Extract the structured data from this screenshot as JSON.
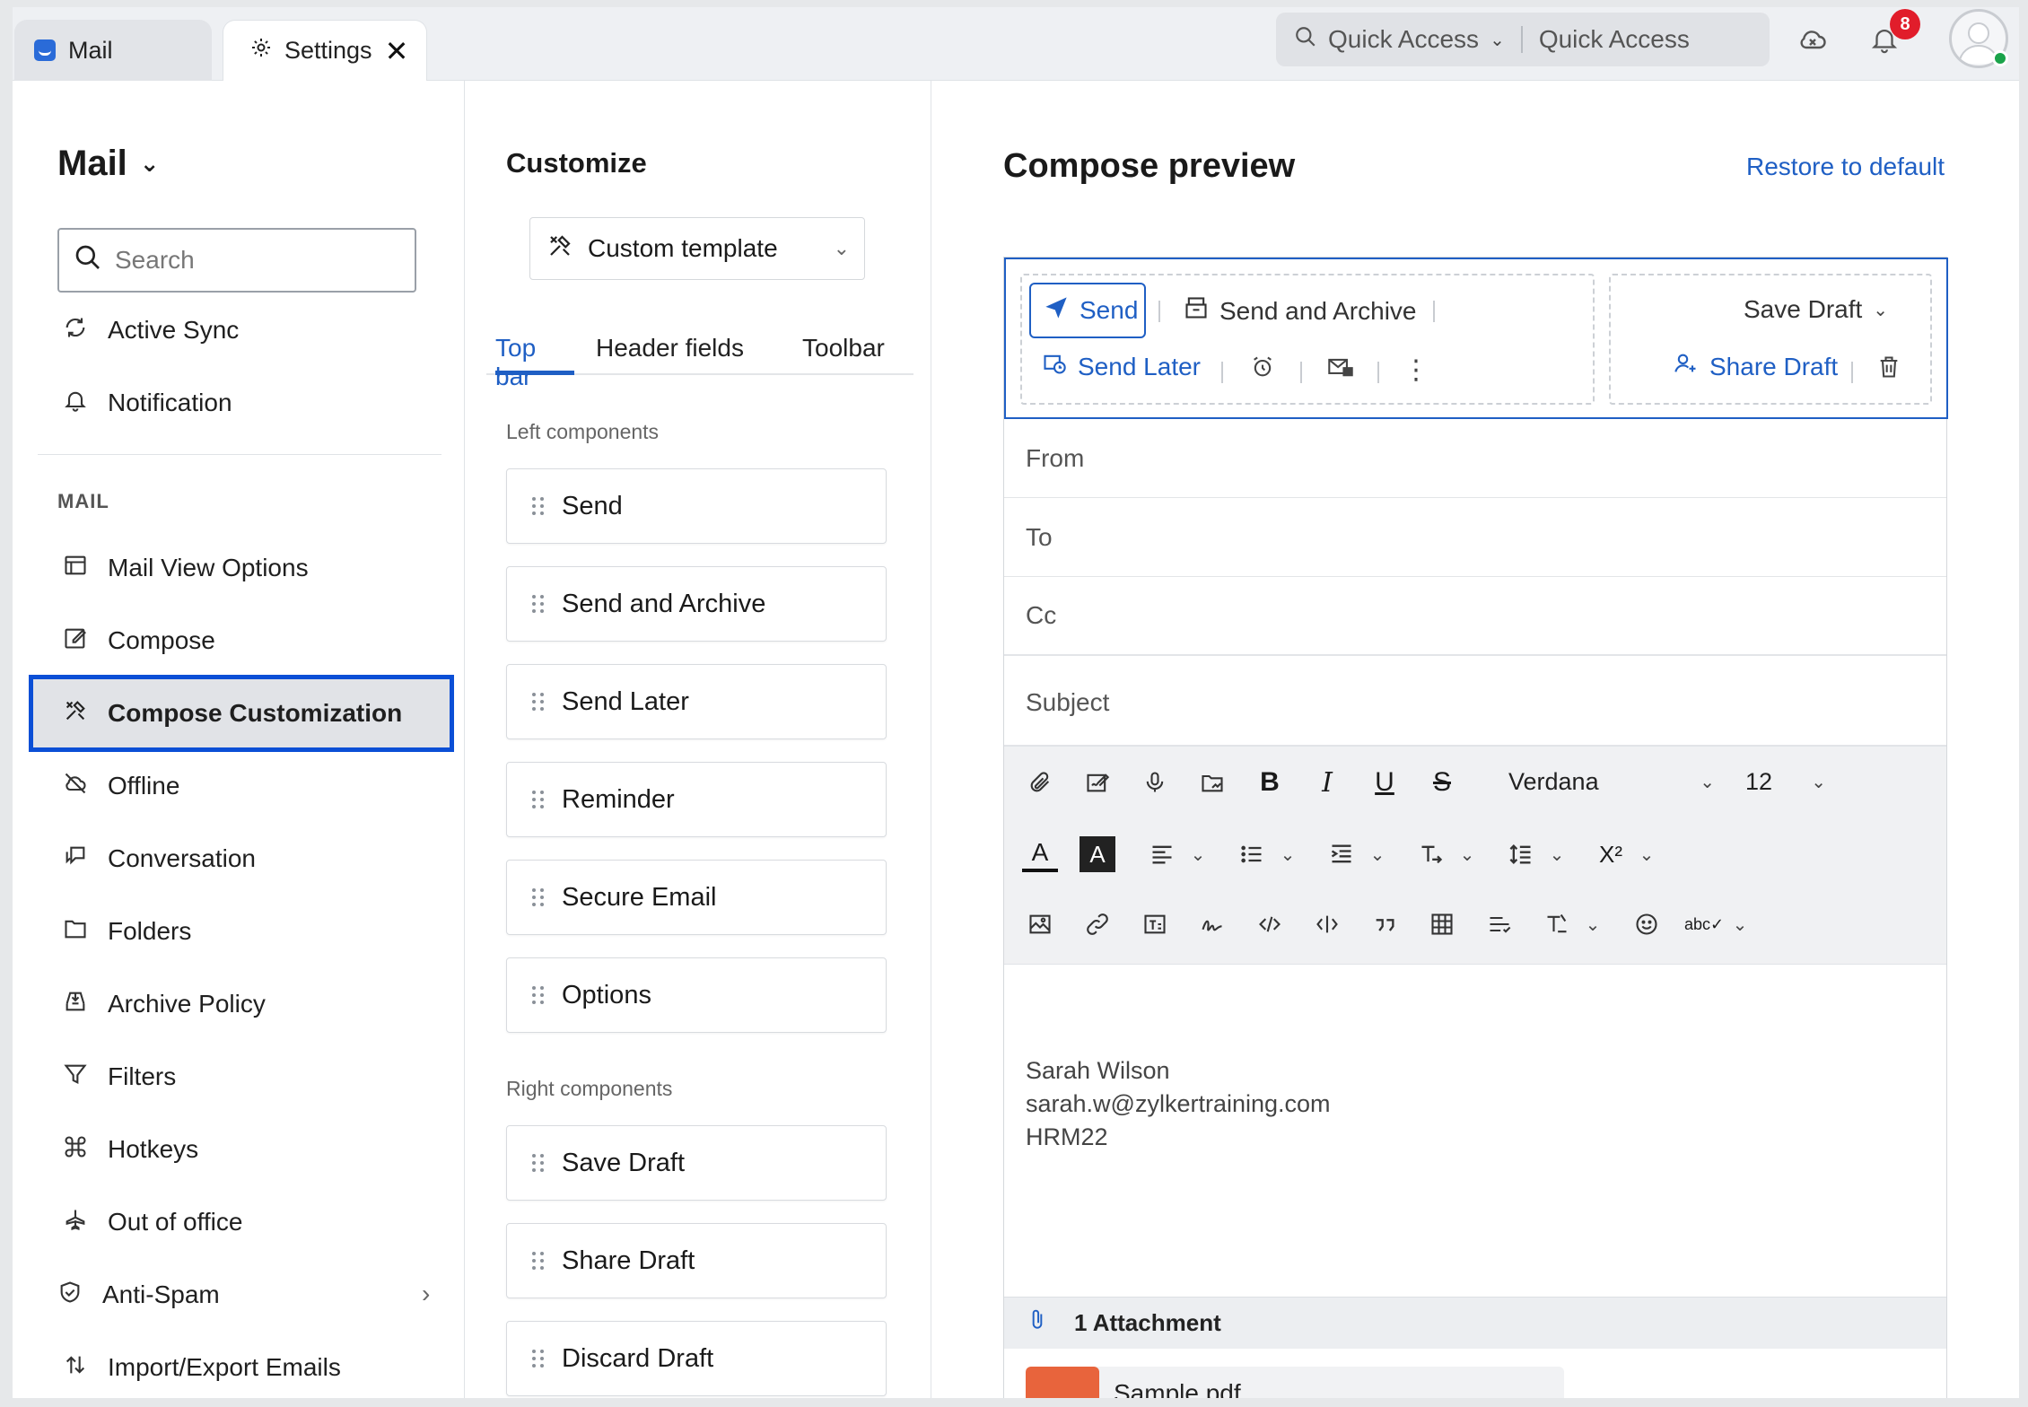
{
  "tabs": [
    {
      "label": "Mail",
      "icon": "mail-app-icon"
    },
    {
      "label": "Settings",
      "icon": "gear-icon"
    }
  ],
  "topbar": {
    "quick_access_label": "Quick Access",
    "quick_access_placeholder": "Quick Access",
    "notification_count": "8"
  },
  "sidebar": {
    "app_title": "Mail",
    "search_placeholder": "Search",
    "top_items": [
      {
        "label": "Active Sync",
        "icon": "sync-icon"
      },
      {
        "label": "Notification",
        "icon": "bell-icon"
      }
    ],
    "section_label": "MAIL",
    "items": [
      {
        "label": "Mail View Options",
        "icon": "layout-icon"
      },
      {
        "label": "Compose",
        "icon": "edit-icon"
      },
      {
        "label": "Compose Customization",
        "icon": "tools-icon",
        "active": true
      },
      {
        "label": "Offline",
        "icon": "cloud-off-icon"
      },
      {
        "label": "Conversation",
        "icon": "chat-icon"
      },
      {
        "label": "Folders",
        "icon": "folder-icon"
      },
      {
        "label": "Archive Policy",
        "icon": "archive-icon"
      },
      {
        "label": "Filters",
        "icon": "filter-icon"
      },
      {
        "label": "Hotkeys",
        "icon": "command-icon"
      },
      {
        "label": "Out of office",
        "icon": "plane-icon"
      },
      {
        "label": "Anti-Spam",
        "icon": "shield-icon"
      },
      {
        "label": "Import/Export Emails",
        "icon": "import-export-icon"
      }
    ]
  },
  "customize": {
    "title": "Customize",
    "template": "Custom template",
    "subtabs": [
      "Top bar",
      "Header fields",
      "Toolbar"
    ],
    "left_label": "Left components",
    "left_components": [
      "Send",
      "Send and Archive",
      "Send Later",
      "Reminder",
      "Secure Email",
      "Options"
    ],
    "right_label": "Right components",
    "right_components": [
      "Save Draft",
      "Share Draft",
      "Discard Draft"
    ]
  },
  "preview": {
    "title": "Compose preview",
    "restore": "Restore to default",
    "send": "Send",
    "send_archive": "Send and Archive",
    "send_later": "Send Later",
    "save_draft": "Save Draft",
    "share_draft": "Share Draft",
    "fields": [
      "From",
      "To",
      "Cc",
      "Subject"
    ],
    "font": "Verdana",
    "font_size": "12",
    "signature": [
      "Sarah Wilson",
      "sarah.w@zylkertraining.com",
      "HRM22"
    ],
    "attachment_label": "1 Attachment",
    "attachment_file": "Sample.pdf"
  },
  "colors": {
    "accent": "#1f5fc4",
    "active_border": "#0b4fd6",
    "badge": "#e11d2b"
  }
}
